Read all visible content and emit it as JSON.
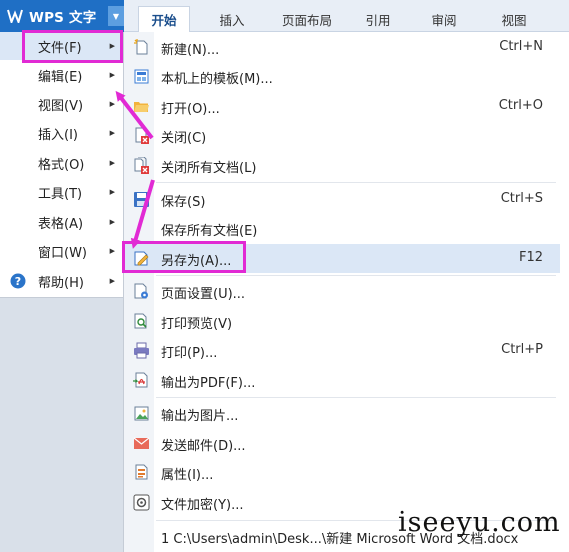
{
  "app": {
    "title": "WPS 文字"
  },
  "ribbon_tabs": [
    {
      "label": "开始"
    },
    {
      "label": "插入"
    },
    {
      "label": "页面布局"
    },
    {
      "label": "引用"
    },
    {
      "label": "审阅"
    },
    {
      "label": "视图"
    }
  ],
  "left_menu": [
    {
      "label": "文件(F)"
    },
    {
      "label": "编辑(E)"
    },
    {
      "label": "视图(V)"
    },
    {
      "label": "插入(I)"
    },
    {
      "label": "格式(O)"
    },
    {
      "label": "工具(T)"
    },
    {
      "label": "表格(A)"
    },
    {
      "label": "窗口(W)"
    },
    {
      "label": "帮助(H)"
    }
  ],
  "file_menu": {
    "new": {
      "label": "新建(N)...",
      "shortcut": "Ctrl+N"
    },
    "template": {
      "label": "本机上的模板(M)..."
    },
    "open": {
      "label": "打开(O)...",
      "shortcut": "Ctrl+O"
    },
    "close": {
      "label": "关闭(C)"
    },
    "close_all": {
      "label": "关闭所有文档(L)"
    },
    "save": {
      "label": "保存(S)",
      "shortcut": "Ctrl+S"
    },
    "save_all": {
      "label": "保存所有文档(E)"
    },
    "save_as": {
      "label": "另存为(A)...",
      "shortcut": "F12"
    },
    "page_setup": {
      "label": "页面设置(U)..."
    },
    "print_preview": {
      "label": "打印预览(V)"
    },
    "print": {
      "label": "打印(P)...",
      "shortcut": "Ctrl+P"
    },
    "export_pdf": {
      "label": "输出为PDF(F)..."
    },
    "export_image": {
      "label": "输出为图片..."
    },
    "send_mail": {
      "label": "发送邮件(D)..."
    },
    "properties": {
      "label": "属性(I)..."
    },
    "encrypt": {
      "label": "文件加密(Y)..."
    },
    "recent_1": {
      "label": "1 C:\\Users\\admin\\Desk...\\新建 Microsoft Word 文档.docx"
    }
  },
  "watermark": "iseeyu.com",
  "colors": {
    "accent": "#1f6fc5",
    "highlight": "#e12ad4",
    "hover": "#dbe7f6"
  }
}
